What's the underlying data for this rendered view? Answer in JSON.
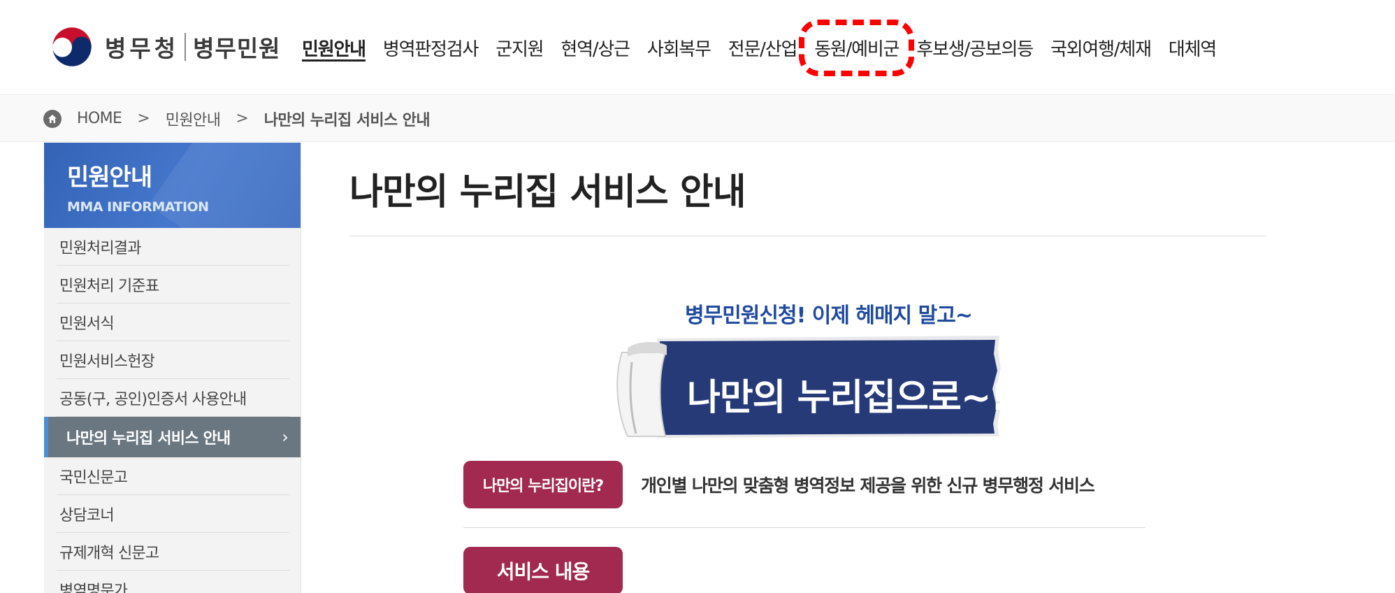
{
  "header": {
    "org_name": "병무청",
    "site_name": "병무민원",
    "nav": [
      {
        "label": "민원안내"
      },
      {
        "label": "병역판정검사"
      },
      {
        "label": "군지원"
      },
      {
        "label": "현역/상근"
      },
      {
        "label": "사회복무"
      },
      {
        "label": "전문/산업"
      },
      {
        "label": "동원/예비군"
      },
      {
        "label": "후보생/공보의등"
      },
      {
        "label": "국외여행/체재"
      },
      {
        "label": "대체역"
      }
    ],
    "active_nav": "민원안내",
    "highlighted_nav": "동원/예비군",
    "highlight_color": "#ff0000"
  },
  "breadcrumb": {
    "home": "HOME",
    "sep": ">",
    "level1": "민원안내",
    "current": "나만의 누리집 서비스 안내"
  },
  "sidebar": {
    "title": "민원안내",
    "subtitle": "MMA INFORMATION",
    "items": [
      {
        "label": "민원처리결과"
      },
      {
        "label": "민원처리 기준표"
      },
      {
        "label": "민원서식"
      },
      {
        "label": "민원서비스헌장"
      },
      {
        "label": "공동(구, 공인)인증서 사용안내"
      },
      {
        "label": "나만의 누리집 서비스 안내"
      },
      {
        "label": "국민신문고"
      },
      {
        "label": "상담코너"
      },
      {
        "label": "규제개혁 신문고"
      },
      {
        "label": "병역명문가"
      }
    ],
    "active_item": "나만의 누리집 서비스 안내",
    "accent_color": "#3463b6"
  },
  "main": {
    "page_title": "나만의 누리집 서비스 안내",
    "banner": {
      "tagline": "병무민원신청! 이제 헤매지 말고~",
      "headline": "나만의 누리집으로~!"
    },
    "what_is": {
      "badge": "나만의 누리집이란?",
      "description": "개인별 나만의 맞춤형 병역정보 제공을 위한 신규 병무행정 서비스"
    },
    "service_button": "서비스 내용",
    "badge_color": "#a2294f"
  }
}
